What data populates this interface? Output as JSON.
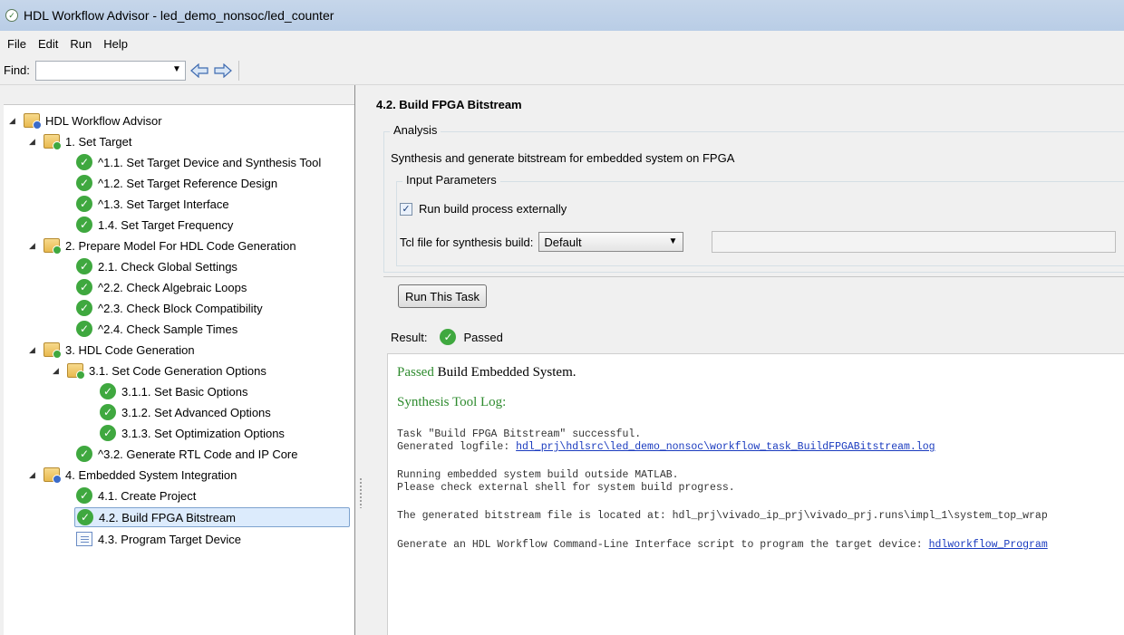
{
  "window": {
    "title": "HDL Workflow Advisor - led_demo_nonsoc/led_counter"
  },
  "menu": {
    "items": [
      "File",
      "Edit",
      "Run",
      "Help"
    ]
  },
  "toolbar": {
    "find_label": "Find:",
    "find_value": ""
  },
  "tree": {
    "root": "HDL Workflow Advisor",
    "items": [
      {
        "label": "1. Set Target"
      },
      {
        "label": "^1.1. Set Target Device and Synthesis Tool"
      },
      {
        "label": "^1.2. Set Target Reference Design"
      },
      {
        "label": "^1.3. Set Target Interface"
      },
      {
        "label": "1.4. Set Target Frequency"
      },
      {
        "label": "2. Prepare Model For HDL Code Generation"
      },
      {
        "label": "2.1. Check Global Settings"
      },
      {
        "label": "^2.2. Check Algebraic Loops"
      },
      {
        "label": "^2.3. Check Block Compatibility"
      },
      {
        "label": "^2.4. Check Sample Times"
      },
      {
        "label": "3. HDL Code Generation"
      },
      {
        "label": "3.1. Set Code Generation Options"
      },
      {
        "label": "3.1.1. Set Basic Options"
      },
      {
        "label": "3.1.2. Set Advanced Options"
      },
      {
        "label": "3.1.3. Set Optimization Options"
      },
      {
        "label": "^3.2. Generate RTL Code and IP Core"
      },
      {
        "label": "4. Embedded System Integration"
      },
      {
        "label": "4.1. Create Project"
      },
      {
        "label": "4.2. Build FPGA Bitstream"
      },
      {
        "label": "4.3. Program Target Device"
      }
    ]
  },
  "task": {
    "title": "4.2. Build FPGA Bitstream",
    "analysis_legend": "Analysis",
    "analysis_desc": "Synthesis and generate bitstream for embedded system on FPGA",
    "input_params_legend": "Input Parameters",
    "run_external_label": "Run build process externally",
    "run_external_checked": true,
    "tcl_label": "Tcl file for synthesis build:",
    "tcl_value": "Default",
    "tcl_path": "",
    "run_button": "Run This Task",
    "result_label": "Result:",
    "result_status": "Passed"
  },
  "result_log": {
    "passed_word": "Passed",
    "passed_rest": " Build Embedded System.",
    "log_heading": "Synthesis Tool Log:",
    "line1": "Task \"Build FPGA Bitstream\" successful.",
    "line2_prefix": "Generated logfile: ",
    "line2_link": "hdl_prj\\hdlsrc\\led_demo_nonsoc\\workflow_task_BuildFPGABitstream.log",
    "line3": "Running embedded system build outside MATLAB.",
    "line4": "Please check external shell for system build progress.",
    "line5": "The generated bitstream file is located at: hdl_prj\\vivado_ip_prj\\vivado_prj.runs\\impl_1\\system_top_wrap",
    "line6_prefix": "Generate an HDL Workflow Command-Line Interface script to program the target device: ",
    "line6_link": "hdlworkflow_Program"
  },
  "colors": {
    "titlebar": "#bfd2e8",
    "check_green": "#3fa83f",
    "link_blue": "#1a3bbf",
    "passed_green": "#2e8b2e",
    "selection": "#dcebfc"
  }
}
